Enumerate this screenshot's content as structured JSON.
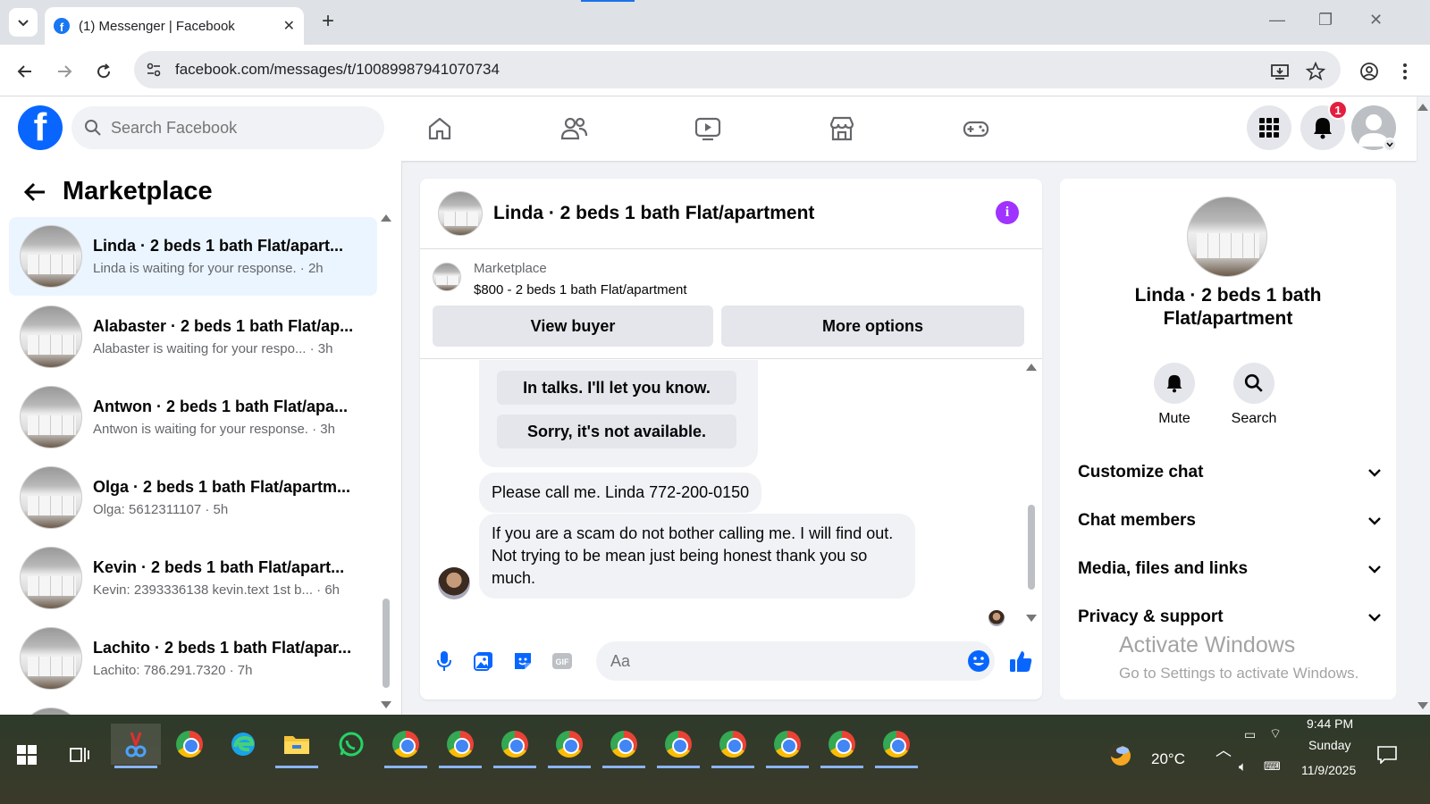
{
  "browser": {
    "tab_title": "(1) Messenger | Facebook",
    "url": "facebook.com/messages/t/10089987941070734"
  },
  "fb_header": {
    "search_placeholder": "Search Facebook",
    "notification_count": "1"
  },
  "left_pane": {
    "title": "Marketplace",
    "conversations": [
      {
        "name": "Linda · 2 beds 1 bath Flat/apart...",
        "preview": "Linda is waiting for your response. · 2h",
        "active": true
      },
      {
        "name": "Alabaster · 2 beds 1 bath Flat/ap...",
        "preview": "Alabaster is waiting for your respo... · 3h",
        "active": false
      },
      {
        "name": "Antwon · 2 beds 1 bath Flat/apa...",
        "preview": "Antwon is waiting for your response. · 3h",
        "active": false
      },
      {
        "name": "Olga · 2 beds 1 bath Flat/apartm...",
        "preview": "Olga: 5612311107 · 5h",
        "active": false
      },
      {
        "name": "Kevin · 2 beds 1 bath Flat/apart...",
        "preview": "Kevin: 2393336138 kevin.text 1st b... · 6h",
        "active": false
      },
      {
        "name": "Lachito · 2 beds 1 bath Flat/apar...",
        "preview": "Lachito: 786.291.7320 · 7h",
        "active": false
      }
    ]
  },
  "chat": {
    "title": "Linda · 2 beds 1 bath Flat/apartment",
    "listing_source": "Marketplace",
    "listing_price_title": "$800 - 2 beds 1 bath Flat/apartment",
    "view_buyer_label": "View buyer",
    "more_options_label": "More options",
    "quick_replies": [
      "In talks. I'll let you know.",
      "Sorry, it's not available."
    ],
    "messages": [
      "Please call me. Linda 772-200-0150",
      "If you are a scam do not bother calling me. I will find out. Not trying to be mean just being honest thank you so much."
    ],
    "composer_placeholder": "Aa"
  },
  "info_pane": {
    "name": "Linda · 2 beds 1 bath Flat/apartment",
    "mute_label": "Mute",
    "search_label": "Search",
    "sections": [
      "Customize chat",
      "Chat members",
      "Media, files and links",
      "Privacy & support"
    ]
  },
  "watermark": {
    "line1": "Activate Windows",
    "line2": "Go to Settings to activate Windows."
  },
  "taskbar": {
    "weather": "20°C",
    "time": "9:44 PM",
    "day": "Sunday",
    "date": "11/9/2025"
  },
  "colors": {
    "fb_blue": "#0866ff",
    "active_row": "#ebf5ff",
    "info_purple": "#a033ff",
    "badge_red": "#e41e3f"
  }
}
